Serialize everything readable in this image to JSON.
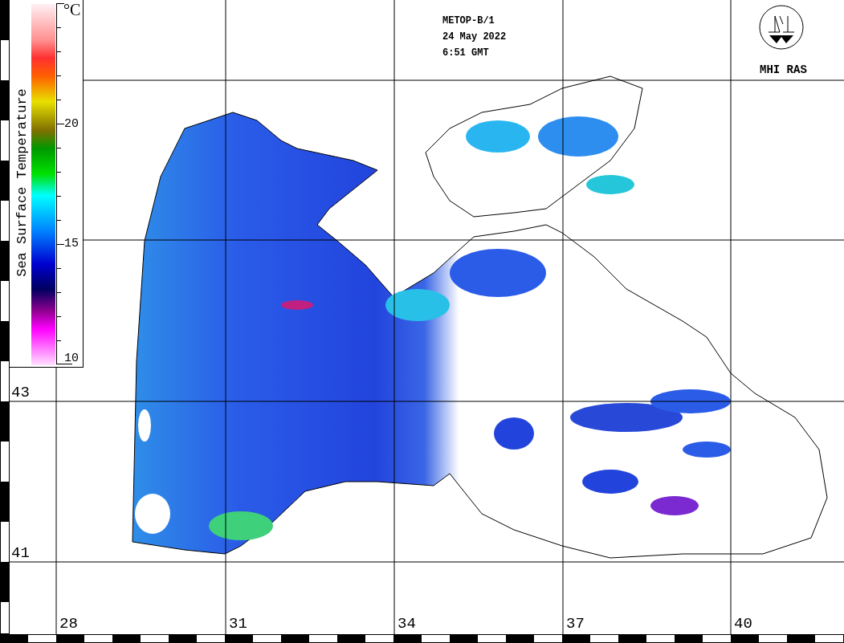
{
  "header": {
    "satellite": "METOP-B/1",
    "date": "24 May 2022",
    "time": "6:51 GMT"
  },
  "logo": {
    "caption": "MHI RAS"
  },
  "colorbar": {
    "title": "Sea Surface Temperature",
    "unit": "°C",
    "ticks": [
      "20",
      "15",
      "10"
    ]
  },
  "map": {
    "latitude_labels": [
      "43",
      "41"
    ],
    "longitude_labels": [
      "28",
      "31",
      "34",
      "37",
      "40"
    ]
  }
}
